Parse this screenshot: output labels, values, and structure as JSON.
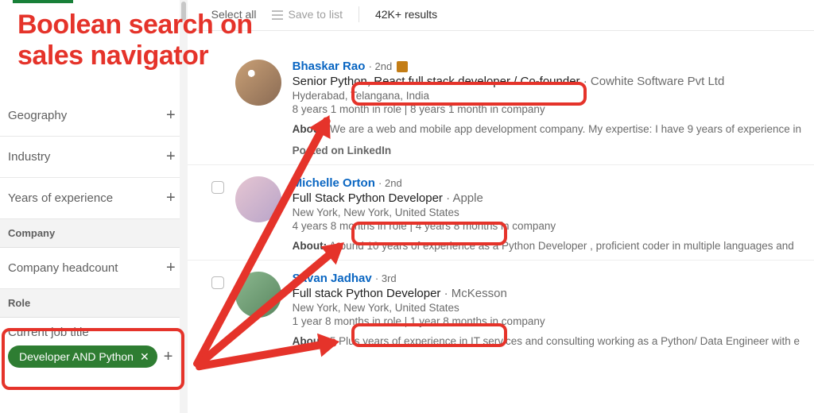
{
  "annotation": {
    "title_l1": "Boolean search on",
    "title_l2": "sales navigator"
  },
  "sidebar": {
    "filters": {
      "geography": "Geography",
      "industry": "Industry",
      "years_exp": "Years of experience",
      "company_headcount": "Company headcount",
      "current_job_title": "Current job title"
    },
    "sections": {
      "company": "Company",
      "role": "Role"
    },
    "chip": {
      "label": "Developer AND Python"
    }
  },
  "topbar": {
    "select_all": "Select all",
    "save_to_list": "Save to list",
    "results": "42K+ results"
  },
  "results": [
    {
      "name": "Bhaskar Rao",
      "degree": "2nd",
      "premium": true,
      "title": "Senior Python, React full stack developer / Co-founder",
      "company": "Cowhite Software Pvt Ltd",
      "location": "Hyderabad, Telangana, India",
      "tenure": "8 years 1 month in role | 8 years 1 month in company",
      "about": "We are a web and mobile app development company. My expertise: I have 9 years of experience in",
      "posted_on": "Posted on LinkedIn",
      "show_checkbox": false
    },
    {
      "name": "Michelle Orton",
      "degree": "2nd",
      "premium": false,
      "title": "Full Stack Python Developer",
      "company": "Apple",
      "location": "New York, New York, United States",
      "tenure": "4 years 8 months in role | 4 years 8 months in company",
      "about": "Around 10 years of experience as a Python Developer , proficient coder in multiple languages and",
      "posted_on": "",
      "show_checkbox": true
    },
    {
      "name": "Savan Jadhav",
      "degree": "3rd",
      "premium": false,
      "title": "Full stack Python Developer",
      "company": "McKesson",
      "location": "New York, New York, United States",
      "tenure": "1 year 8 months in role | 1 year 8 months in company",
      "about": "5 Plus years of experience in IT services and consulting working as a Python/ Data Engineer with e",
      "posted_on": "",
      "show_checkbox": true
    }
  ],
  "labels": {
    "about": "About:"
  },
  "colors": {
    "annotation_red": "#e5332a",
    "chip_green": "#2e7d32",
    "link_blue": "#0a66c2"
  }
}
